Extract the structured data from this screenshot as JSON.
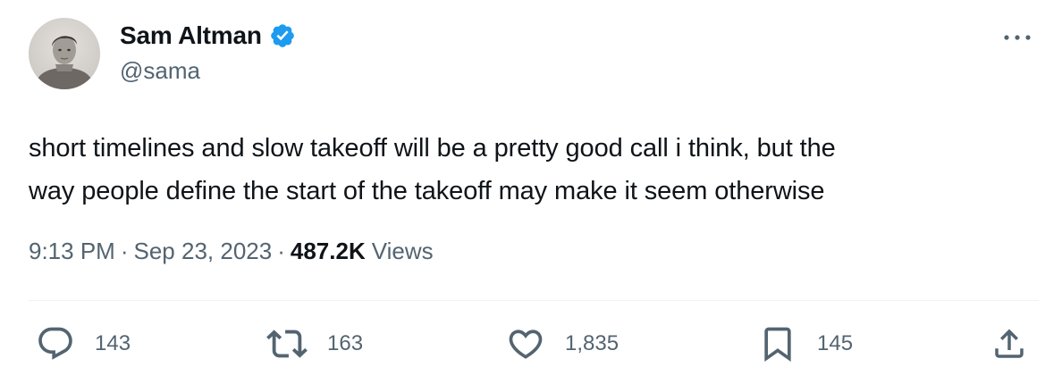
{
  "author": {
    "name": "Sam Altman",
    "handle": "@sama",
    "verified": true,
    "verified_color": "#1d9bf0"
  },
  "tweet": {
    "text": "short timelines and slow takeoff will be a pretty good call i think, but the\nway people define the start of the takeoff may make it seem otherwise",
    "time": "9:13 PM",
    "separator": "·",
    "date": "Sep 23, 2023",
    "views_count": "487.2K",
    "views_label": "Views"
  },
  "actions": {
    "replies": "143",
    "reposts": "163",
    "likes": "1,835",
    "bookmarks": "145"
  },
  "icons": {
    "more": "more-horizontal-icon",
    "reply": "reply-icon",
    "repost": "repost-icon",
    "like": "heart-icon",
    "bookmark": "bookmark-icon",
    "share": "share-icon"
  },
  "colors": {
    "text_primary": "#0f1419",
    "text_secondary": "#536471",
    "divider": "#eff3f4",
    "verified": "#1d9bf0"
  }
}
